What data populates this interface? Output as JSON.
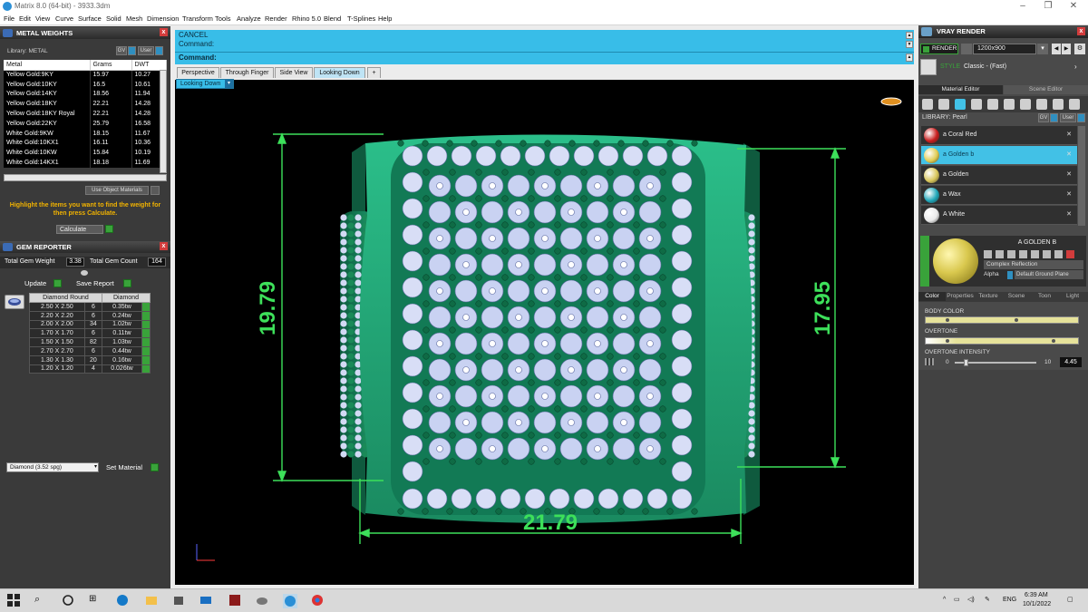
{
  "window": {
    "title": "Matrix 8.0 (64-bit) - 3933.3dm"
  },
  "menu": [
    "File",
    "Edit",
    "View",
    "Curve",
    "Surface",
    "Solid",
    "Mesh",
    "Dimension",
    "Transform",
    "Tools",
    "Analyze",
    "Render",
    "Rhino 5.0",
    "Blend",
    "T-Splines",
    "Help"
  ],
  "metal_weights": {
    "title": "METAL WEIGHTS",
    "library_label": "Library: METAL",
    "gv_label": "GV",
    "user_label": "User",
    "columns": [
      "Metal",
      "Grams",
      "DWT"
    ],
    "rows": [
      [
        "Yellow Gold:9KY",
        "15.97",
        "10.27"
      ],
      [
        "Yellow Gold:10KY",
        "16.5",
        "10.61"
      ],
      [
        "Yellow Gold:14KY",
        "18.56",
        "11.94"
      ],
      [
        "Yellow Gold:18KY",
        "22.21",
        "14.28"
      ],
      [
        "Yellow Gold:18KY Royal",
        "22.21",
        "14.28"
      ],
      [
        "Yellow Gold:22KY",
        "25.79",
        "16.58"
      ],
      [
        "White Gold:9KW",
        "18.15",
        "11.67"
      ],
      [
        "White Gold:10KX1",
        "16.11",
        "10.36"
      ],
      [
        "White Gold:10KW",
        "15.84",
        "10.19"
      ],
      [
        "White Gold:14KX1",
        "18.18",
        "11.69"
      ]
    ],
    "use_object_materials": "Use Object Materials",
    "message": "Highlight the items you want to find the weight for then press Calculate.",
    "calculate_label": "Calculate"
  },
  "gem_reporter": {
    "title": "GEM REPORTER",
    "total_weight_label": "Total Gem Weight",
    "total_weight_value": "3.38",
    "total_count_label": "Total Gem Count",
    "total_count_value": "164",
    "update_label": "Update",
    "save_report_label": "Save Report",
    "columns": [
      "Diamond Round",
      "Diamond"
    ],
    "rows": [
      [
        "2.50 X 2.50",
        "6",
        "0.35tw"
      ],
      [
        "2.20 X 2.20",
        "6",
        "0.24tw"
      ],
      [
        "2.00 X 2.00",
        "34",
        "1.02tw"
      ],
      [
        "1.70 X 1.70",
        "6",
        "0.11tw"
      ],
      [
        "1.50 X 1.50",
        "82",
        "1.03tw"
      ],
      [
        "2.70 X 2.70",
        "6",
        "0.44tw"
      ],
      [
        "1.30 X 1.30",
        "20",
        "0.16tw"
      ],
      [
        "1.20 X 1.20",
        "4",
        "0.026tw"
      ]
    ],
    "material_select": "Diamond    (3.52 spg)",
    "set_material_label": "Set Material"
  },
  "command": {
    "line1": "CANCEL",
    "line2": "Command:",
    "prompt": "Command:"
  },
  "tabs": [
    "Perspective",
    "Through Finger",
    "Side View",
    "Looking Down"
  ],
  "active_tab": "Looking Down",
  "view_label": "Looking Down",
  "dimensions": {
    "height_left": "19.79",
    "height_right": "17.95",
    "width": "21.79"
  },
  "vray": {
    "title": "VRAY RENDER",
    "render_label": "RENDER",
    "resolution": "1200x900",
    "style_prefix": "STYLE",
    "style_value": "Classic - (Fast)",
    "tab_material": "Material Editor",
    "tab_scene": "Scene Editor",
    "library_label": "LIBRARY: Pearl",
    "gv_label": "GV",
    "user_label": "User",
    "materials": [
      {
        "name": "a Coral Red",
        "color": "#c81d1d"
      },
      {
        "name": "a Golden b",
        "color": "#e0cc52"
      },
      {
        "name": "a Golden",
        "color": "#d8c65a"
      },
      {
        "name": "a Wax",
        "color": "#1fa6b8"
      },
      {
        "name": "A White",
        "color": "#e9e9e9"
      }
    ],
    "selected_material": "A GOLDEN B",
    "reflection": "Complex Reflection",
    "alpha_label": "Alpha",
    "ground_plane": "Default Ground Plane",
    "subtabs": [
      "Color",
      "Properties",
      "Texture",
      "Scene",
      "Toon",
      "Light"
    ],
    "body_color_label": "BODY COLOR",
    "overtone_label": "OVERTONE",
    "overtone_intensity_label": "OVERTONE INTENSITY",
    "intensity_min": "0",
    "intensity_max": "10",
    "intensity_value": "4.45"
  },
  "taskbar": {
    "language": "ENG",
    "time": "6:39 AM",
    "date": "10/1/2022"
  }
}
